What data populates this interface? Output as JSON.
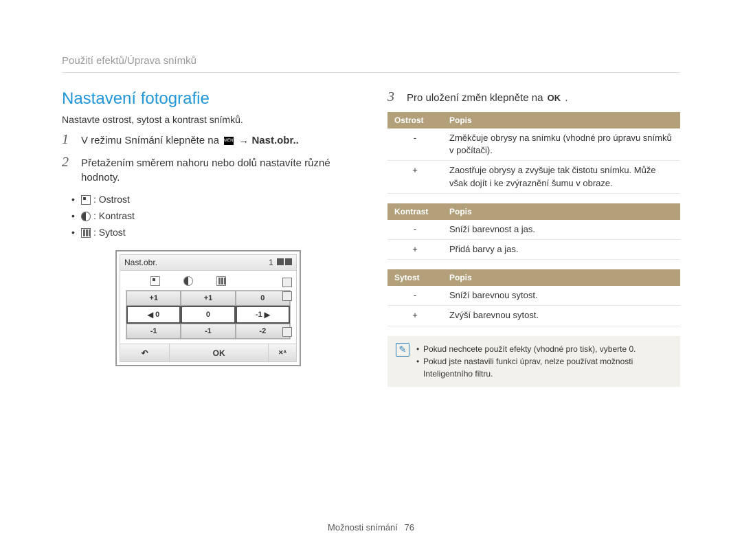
{
  "breadcrumb": "Použití efektů/Úprava snímků",
  "title": "Nastavení fotografie",
  "intro": "Nastavte ostrost, sytost a kontrast snímků.",
  "step1": {
    "num": "1",
    "pre": "V režimu Snímání klepněte na ",
    "menu_label": "MENU",
    "arrow": "→",
    "target": "Nast.obr.."
  },
  "step2": {
    "num": "2",
    "text": "Přetažením směrem nahoru nebo dolů nastavíte různé hodnoty."
  },
  "bullets": {
    "sharp": ": Ostrost",
    "contrast": ": Kontrast",
    "sat": ": Sytost"
  },
  "screen": {
    "title": "Nast.obr.",
    "count": "1",
    "rows": {
      "r1": [
        "+1",
        "+1",
        "0"
      ],
      "r2": [
        "0",
        "0",
        "-1"
      ],
      "r3": [
        "-1",
        "-1",
        "-2"
      ]
    },
    "back": "↶",
    "ok": "OK",
    "meta": "✕ᴬ"
  },
  "step3": {
    "num": "3",
    "pre": "Pro uložení změn klepněte na ",
    "ok": "OK",
    "post": " ."
  },
  "tbl1": {
    "h1": "Ostrost",
    "h2": "Popis",
    "r1k": "-",
    "r1v": "Změkčuje obrysy na snímku (vhodné pro úpravu snímků v počítači).",
    "r2k": "+",
    "r2v": "Zaostřuje obrysy a zvyšuje tak čistotu snímku. Může však dojít i ke zvýraznění šumu v obraze."
  },
  "tbl2": {
    "h1": "Kontrast",
    "h2": "Popis",
    "r1k": "-",
    "r1v": "Sníží barevnost a jas.",
    "r2k": "+",
    "r2v": "Přidá barvy a jas."
  },
  "tbl3": {
    "h1": "Sytost",
    "h2": "Popis",
    "r1k": "-",
    "r1v": "Sníží barevnou sytost.",
    "r2k": "+",
    "r2v": "Zvýší barevnou sytost."
  },
  "note": {
    "icon": "✎",
    "li1": "Pokud nechcete použít efekty (vhodné pro tisk), vyberte 0.",
    "li2": "Pokud jste nastavili funkci úprav, nelze používat možnosti Inteligentního filtru."
  },
  "footer": {
    "section": "Možnosti snímání",
    "page": "76"
  }
}
